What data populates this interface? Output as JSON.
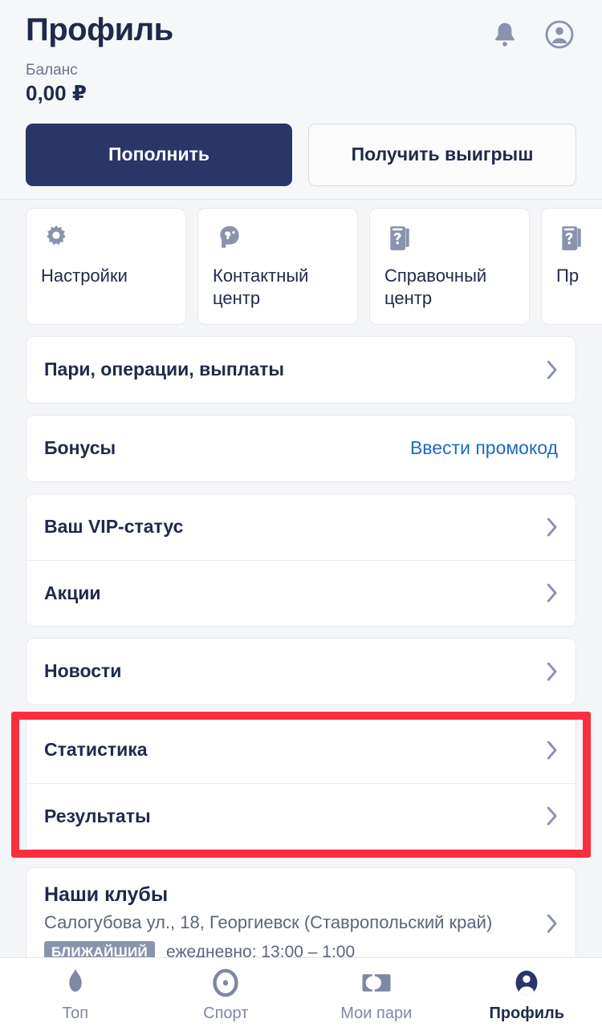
{
  "header": {
    "title": "Профиль",
    "balance_label": "Баланс",
    "balance_value": "0,00 ₽",
    "bell_icon": "bell-icon",
    "account_icon": "account-circle-icon",
    "deposit_label": "Пополнить",
    "withdraw_label": "Получить выигрыш"
  },
  "tiles": [
    {
      "label": "Настройки",
      "icon": "gear-icon"
    },
    {
      "label": "Контактный центр",
      "icon": "support-headset-icon"
    },
    {
      "label": "Справочный центр",
      "icon": "help-book-icon"
    },
    {
      "label": "Пр",
      "icon": "help-book-icon"
    }
  ],
  "groups": [
    {
      "name": "bets-group",
      "rows": [
        {
          "label": "Пари, операции, выплаты",
          "action": "chevron",
          "link": ""
        }
      ]
    },
    {
      "name": "bonus-group",
      "rows": [
        {
          "label": "Бонусы",
          "action": "link",
          "link": "Ввести промокод"
        }
      ]
    },
    {
      "name": "status-group",
      "rows": [
        {
          "label": "Ваш VIP-статус",
          "action": "chevron",
          "link": ""
        },
        {
          "label": "Акции",
          "action": "chevron",
          "link": ""
        }
      ]
    },
    {
      "name": "news-group",
      "rows": [
        {
          "label": "Новости",
          "action": "chevron",
          "link": ""
        }
      ]
    }
  ],
  "highlighted_group": {
    "name": "stats-results-group",
    "highlight_color": "#fa2e3e",
    "rows": [
      {
        "label": "Статистика",
        "action": "chevron",
        "link": ""
      },
      {
        "label": "Результаты",
        "action": "chevron",
        "link": ""
      }
    ]
  },
  "clubs": {
    "title": "Наши клубы",
    "address": "Салогубова ул., 18, Георгиевск (Ставропольский край)",
    "badge": "БЛИЖАЙШИЙ",
    "hours": "ежедневно: 13:00 – 1:00"
  },
  "tabbar": [
    {
      "label": "Топ",
      "icon": "flame-icon",
      "active": false
    },
    {
      "label": "Спорт",
      "icon": "target-icon",
      "active": false
    },
    {
      "label": "Мои пари",
      "icon": "ticket-icon",
      "active": false
    },
    {
      "label": "Профиль",
      "icon": "person-icon",
      "active": true
    }
  ],
  "colors": {
    "brand_navy": "#2a3568",
    "text_dark": "#1f2a4a",
    "muted": "#6b7487",
    "link_blue": "#1b6bc0",
    "highlight_red": "#fa2e3e",
    "icon_gray": "#8a93ad",
    "page_bg": "#f4f5f7"
  }
}
